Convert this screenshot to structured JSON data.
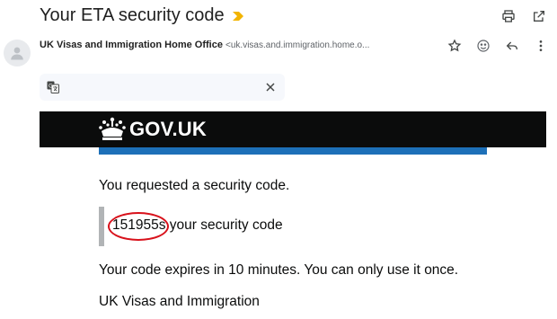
{
  "email": {
    "subject": "Your ETA security code",
    "sender_name": "UK Visas and Immigration Home Office",
    "sender_email": "<uk.visas.and.immigration.home.o..."
  },
  "icons": {
    "importance": "importance-marker-icon",
    "print": "print-icon",
    "open_new": "open-in-new-window-icon",
    "avatar": "person-icon",
    "star": "star-icon",
    "emoji": "emoji-icon",
    "reply": "reply-icon",
    "more": "more-vert-icon",
    "translate": "translate-icon",
    "close": "close-icon",
    "crown": "crown-icon"
  },
  "body": {
    "govuk_logo": "GOV.UK",
    "line1": "You requested a security code.",
    "code": "151955",
    "code_suffix": "s your security code",
    "line3": "Your code expires in 10 minutes. You can only use it once.",
    "signoff": "UK Visas and Immigration"
  },
  "colors": {
    "govuk_black": "#0b0c0c",
    "govuk_blue": "#1d70b8",
    "inset_grey": "#b1b4b6",
    "annotation_red": "#d8111b",
    "importance_yellow": "#f2b400"
  }
}
